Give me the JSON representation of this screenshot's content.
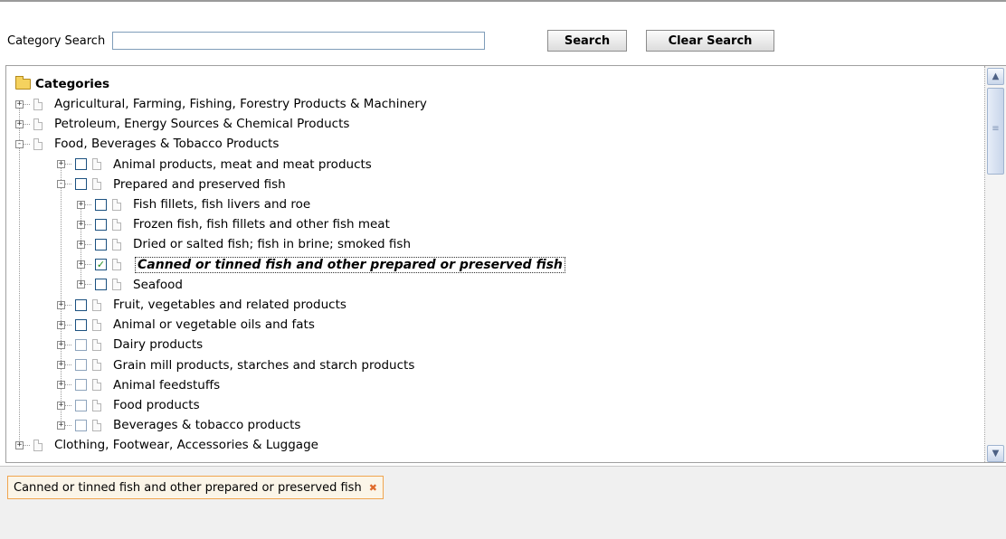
{
  "search": {
    "label": "Category Search",
    "value": "",
    "placeholder": "",
    "search_button": "Search",
    "clear_button": "Clear Search"
  },
  "tree": {
    "root_label": "Categories",
    "items": [
      {
        "label": "Agricultural, Farming, Fishing, Forestry Products & Machinery",
        "level": 1,
        "checkbox": false,
        "expander": "+"
      },
      {
        "label": "Petroleum, Energy Sources & Chemical Products",
        "level": 1,
        "checkbox": false,
        "expander": "+"
      },
      {
        "label": "Food, Beverages & Tobacco Products",
        "level": 1,
        "checkbox": false,
        "expander": "-"
      },
      {
        "label": "Animal products, meat and meat products",
        "level": 2,
        "checkbox": true,
        "checked": false,
        "expander": "+"
      },
      {
        "label": "Prepared and preserved fish",
        "level": 2,
        "checkbox": true,
        "checked": false,
        "expander": "-"
      },
      {
        "label": "Fish fillets, fish livers and roe",
        "level": 3,
        "checkbox": true,
        "checked": false,
        "expander": "+"
      },
      {
        "label": "Frozen fish, fish fillets and other fish meat",
        "level": 3,
        "checkbox": true,
        "checked": false,
        "expander": "+"
      },
      {
        "label": "Dried or salted fish; fish in brine; smoked fish",
        "level": 3,
        "checkbox": true,
        "checked": false,
        "expander": "+"
      },
      {
        "label": "Canned or tinned fish and other prepared or preserved fish",
        "level": 3,
        "checkbox": true,
        "checked": true,
        "selected": true,
        "expander": "+"
      },
      {
        "label": "Seafood",
        "level": 3,
        "checkbox": true,
        "checked": false,
        "expander": "+"
      },
      {
        "label": "Fruit, vegetables and related products",
        "level": 2,
        "checkbox": true,
        "checked": false,
        "expander": "+"
      },
      {
        "label": "Animal or vegetable oils and fats",
        "level": 2,
        "checkbox": true,
        "checked": false,
        "expander": "+"
      },
      {
        "label": "Dairy products",
        "level": 2,
        "checkbox": true,
        "checked": false,
        "light": true,
        "expander": "+"
      },
      {
        "label": "Grain mill products, starches and starch products",
        "level": 2,
        "checkbox": true,
        "checked": false,
        "light": true,
        "expander": "+"
      },
      {
        "label": "Animal feedstuffs",
        "level": 2,
        "checkbox": true,
        "checked": false,
        "light": true,
        "expander": "+"
      },
      {
        "label": "Food products",
        "level": 2,
        "checkbox": true,
        "checked": false,
        "light": true,
        "expander": "+"
      },
      {
        "label": "Beverages & tobacco products",
        "level": 2,
        "checkbox": true,
        "checked": false,
        "light": true,
        "expander": "+"
      },
      {
        "label": "Clothing, Footwear, Accessories & Luggage",
        "level": 1,
        "checkbox": false,
        "expander": "+"
      }
    ]
  },
  "selected_tags": [
    {
      "label": "Canned or tinned fish and other prepared or preserved fish",
      "remove_icon": "close-icon"
    }
  ],
  "colors": {
    "tag_border": "#f0a54f",
    "checkmark": "#1e8a1e",
    "checkbox_border": "#1c5180"
  }
}
